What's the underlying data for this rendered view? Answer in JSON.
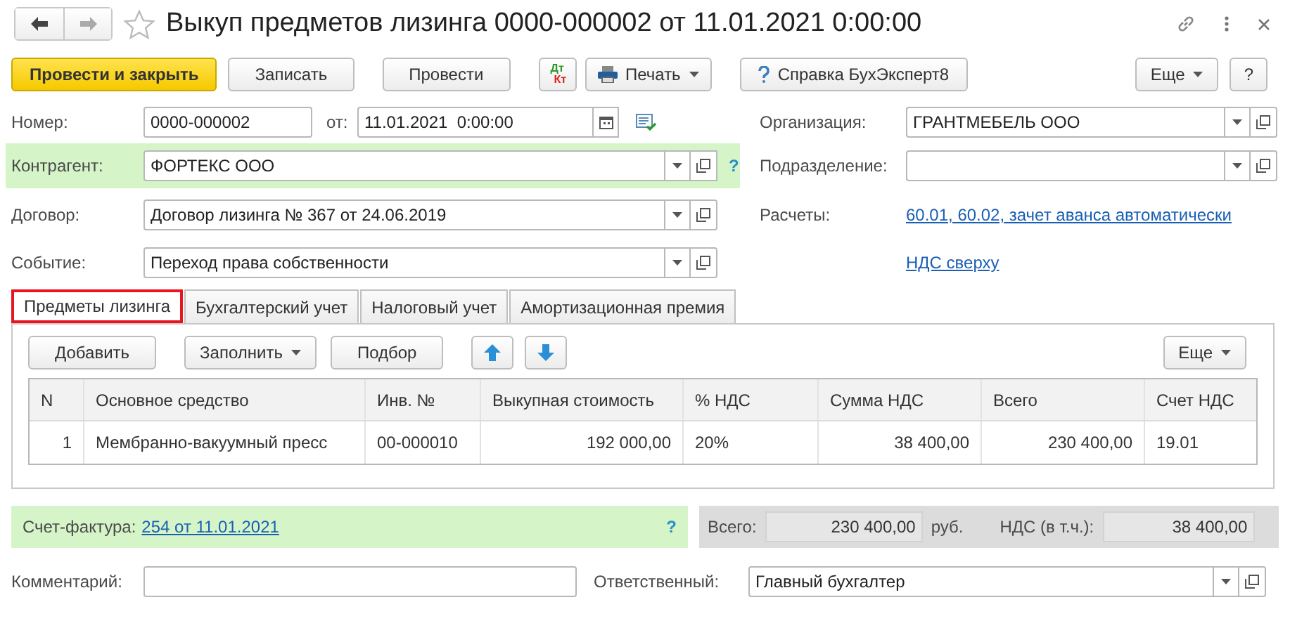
{
  "window": {
    "title": "Выкуп предметов лизинга 0000-000002 от 11.01.2021 0:00:00"
  },
  "toolbar": [
    {
      "kind": "primary",
      "label": "Провести и закрыть"
    },
    {
      "kind": "button",
      "label": "Записать"
    },
    {
      "kind": "button",
      "label": "Провести"
    },
    {
      "kind": "dtkt",
      "label": "Дт",
      "label2": "Кт"
    },
    {
      "kind": "print",
      "label": "Печать"
    },
    {
      "kind": "help",
      "label": "Справка БухЭксперт8"
    }
  ],
  "toolbar_right": [
    {
      "kind": "menu",
      "label": "Еще"
    },
    {
      "kind": "button",
      "label": "?"
    }
  ],
  "number": {
    "label": "Номер:",
    "value": "0000-000002"
  },
  "date": {
    "label": "от:",
    "value": "11.01.2021  0:00:00"
  },
  "organization": {
    "label": "Организация:",
    "value": "ГРАНТМЕБЕЛЬ ООО"
  },
  "counterparty": {
    "label": "Контрагент:",
    "value": "ФОРТЕКС ООО",
    "help": "?"
  },
  "subdivision": {
    "label": "Подразделение:"
  },
  "contract": {
    "label": "Договор:",
    "value": "Договор лизинга № 367 от 24.06.2019"
  },
  "settlements": {
    "label": "Расчеты:",
    "link": "60.01, 60.02, зачет аванса автоматически"
  },
  "event": {
    "label": "Событие:",
    "value": "Переход права собственности"
  },
  "vat_link": "НДС сверху",
  "tabs": [
    {
      "label": "Предметы лизинга",
      "selected": true
    },
    {
      "label": "Бухгалтерский учет",
      "selected": false
    },
    {
      "label": "Налоговый учет",
      "selected": false
    },
    {
      "label": "Амортизационная премия",
      "selected": false
    }
  ],
  "table_toolbar": [
    {
      "kind": "button",
      "label": "Добавить"
    },
    {
      "kind": "menu",
      "label": "Заполнить"
    },
    {
      "kind": "button",
      "label": "Подбор"
    },
    {
      "kind": "up"
    },
    {
      "kind": "down"
    }
  ],
  "table_toolbar_right": {
    "label": "Еще"
  },
  "table": {
    "columns": [
      "N",
      "Основное средство",
      "Инв. №",
      "Выкупная стоимость",
      "% НДС",
      "Сумма НДС",
      "Всего",
      "Счет НДС"
    ],
    "rows": [
      [
        "1",
        "Мембранно-вакуумный пресс",
        "00-000010",
        "192 000,00",
        "20%",
        "38 400,00",
        "230 400,00",
        "19.01"
      ]
    ]
  },
  "invoice": {
    "label": "Счет-фактура:",
    "link": "254 от 11.01.2021",
    "help": "?"
  },
  "totals": {
    "total_label": "Всего:",
    "total": "230 400,00",
    "currency": "руб.",
    "vat_label": "НДС (в т.ч.):",
    "vat": "38 400,00"
  },
  "comment": {
    "label": "Комментарий:"
  },
  "responsible": {
    "label": "Ответственный:",
    "value": "Главный бухгалтер"
  }
}
